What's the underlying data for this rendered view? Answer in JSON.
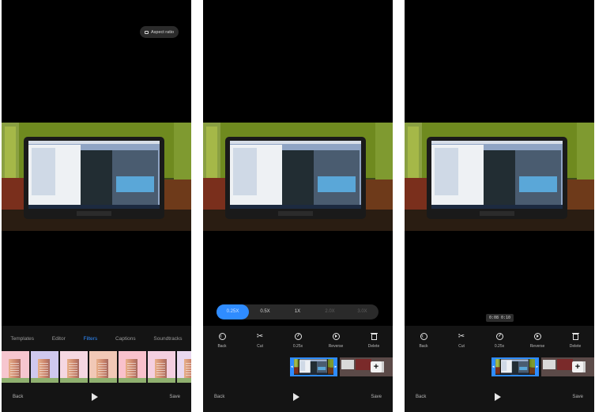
{
  "screen1": {
    "aspect_ratio_label": "Aspect ratio",
    "tabs": [
      {
        "label": "Templates"
      },
      {
        "label": "Editor"
      },
      {
        "label": "Filters"
      },
      {
        "label": "Captions"
      },
      {
        "label": "Soundtracks"
      }
    ],
    "active_tab": "Filters",
    "filter_tints": [
      "#f6c6cf",
      "#cfc8ee",
      "#f5d7e2",
      "#f1c8b6",
      "#f9c1cc",
      "#f4cfe0",
      "#e9d8ef"
    ],
    "back_label": "Back",
    "save_label": "Save"
  },
  "screen2": {
    "speeds": [
      {
        "label": "0.25X",
        "state": "active"
      },
      {
        "label": "0.5X",
        "state": "normal"
      },
      {
        "label": "1X",
        "state": "normal"
      },
      {
        "label": "2.0X",
        "state": "dim"
      },
      {
        "label": "3.0X",
        "state": "dim"
      }
    ],
    "tools": [
      {
        "icon": "back-icon",
        "label": "Back"
      },
      {
        "icon": "scissors-icon",
        "label": "Cut"
      },
      {
        "icon": "speed-icon",
        "label": "0.25x"
      },
      {
        "icon": "reverse-icon",
        "label": "Reverse"
      },
      {
        "icon": "trash-icon",
        "label": "Delete"
      }
    ],
    "back_label": "Back",
    "save_label": "Save"
  },
  "screen3": {
    "time_tag": "0:08 0:10",
    "tools": [
      {
        "icon": "back-icon",
        "label": "Back"
      },
      {
        "icon": "scissors-icon",
        "label": "Cut"
      },
      {
        "icon": "speed-icon",
        "label": "0.25x"
      },
      {
        "icon": "reverse-icon",
        "label": "Reverse"
      },
      {
        "icon": "trash-icon",
        "label": "Delete"
      }
    ],
    "back_label": "Back",
    "save_label": "Save"
  },
  "colors": {
    "accent": "#2f8cff",
    "background": "#000000",
    "panel": "#141414"
  }
}
